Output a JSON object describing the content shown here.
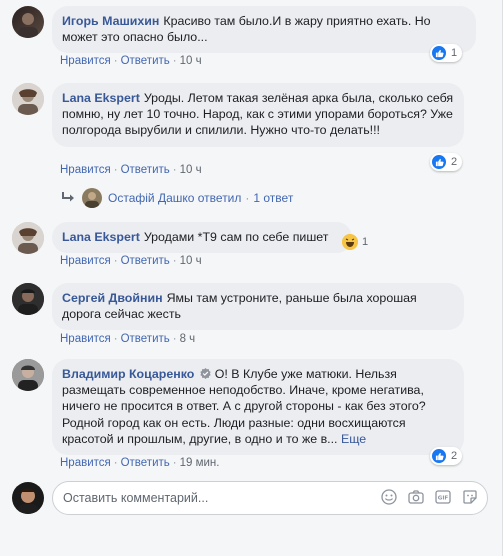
{
  "actions": {
    "like": "Нравится",
    "reply": "Ответить",
    "sep": "·"
  },
  "comments": [
    {
      "author": "Игорь Машихин",
      "text": "Красиво там было.И в жару приятно ехать. Но может это опасно было...",
      "time": "10 ч",
      "reactions": "1"
    },
    {
      "author": "Lana Ekspert",
      "text": "Уроды. Летом такая зелёная арка была, сколько себя помню, ну лет 10 точно. Народ, как с этими упорами бороться? Уже полгорода вырубили и спилили. Нужно что-то делать!!!",
      "time": "10 ч",
      "reactions": "2"
    },
    {
      "author": "Lana Ekspert",
      "text": "Уродами *Т9 сам по себе пишет",
      "time": "10 ч",
      "reactions": "1"
    },
    {
      "author": "Сергей Двойнин",
      "text": "Ямы там устроните, раньше была хорошая дорога сейчас жесть",
      "time": "8 ч"
    },
    {
      "author": "Владимир Коцаренко",
      "text": "О! В Клубе уже матюки. Нельзя размещать современное неподобство. Иначе, кроме негатива, ничего не просится в ответ. А с другой стороны - как без этого? Родной город как он есть. Люди разные: одни восхищаются красотой и прошлым, другие, в одно и то же в...",
      "more": "Еще",
      "time": "19 мин.",
      "reactions": "2"
    }
  ],
  "reply_summary": {
    "name": "Остафій Дашко ответил",
    "count": "1 ответ"
  },
  "composer": {
    "placeholder": "Оставить комментарий..."
  },
  "colors": {
    "link": "#385898",
    "bubble": "#ebedf0",
    "like": "#1877f2"
  }
}
